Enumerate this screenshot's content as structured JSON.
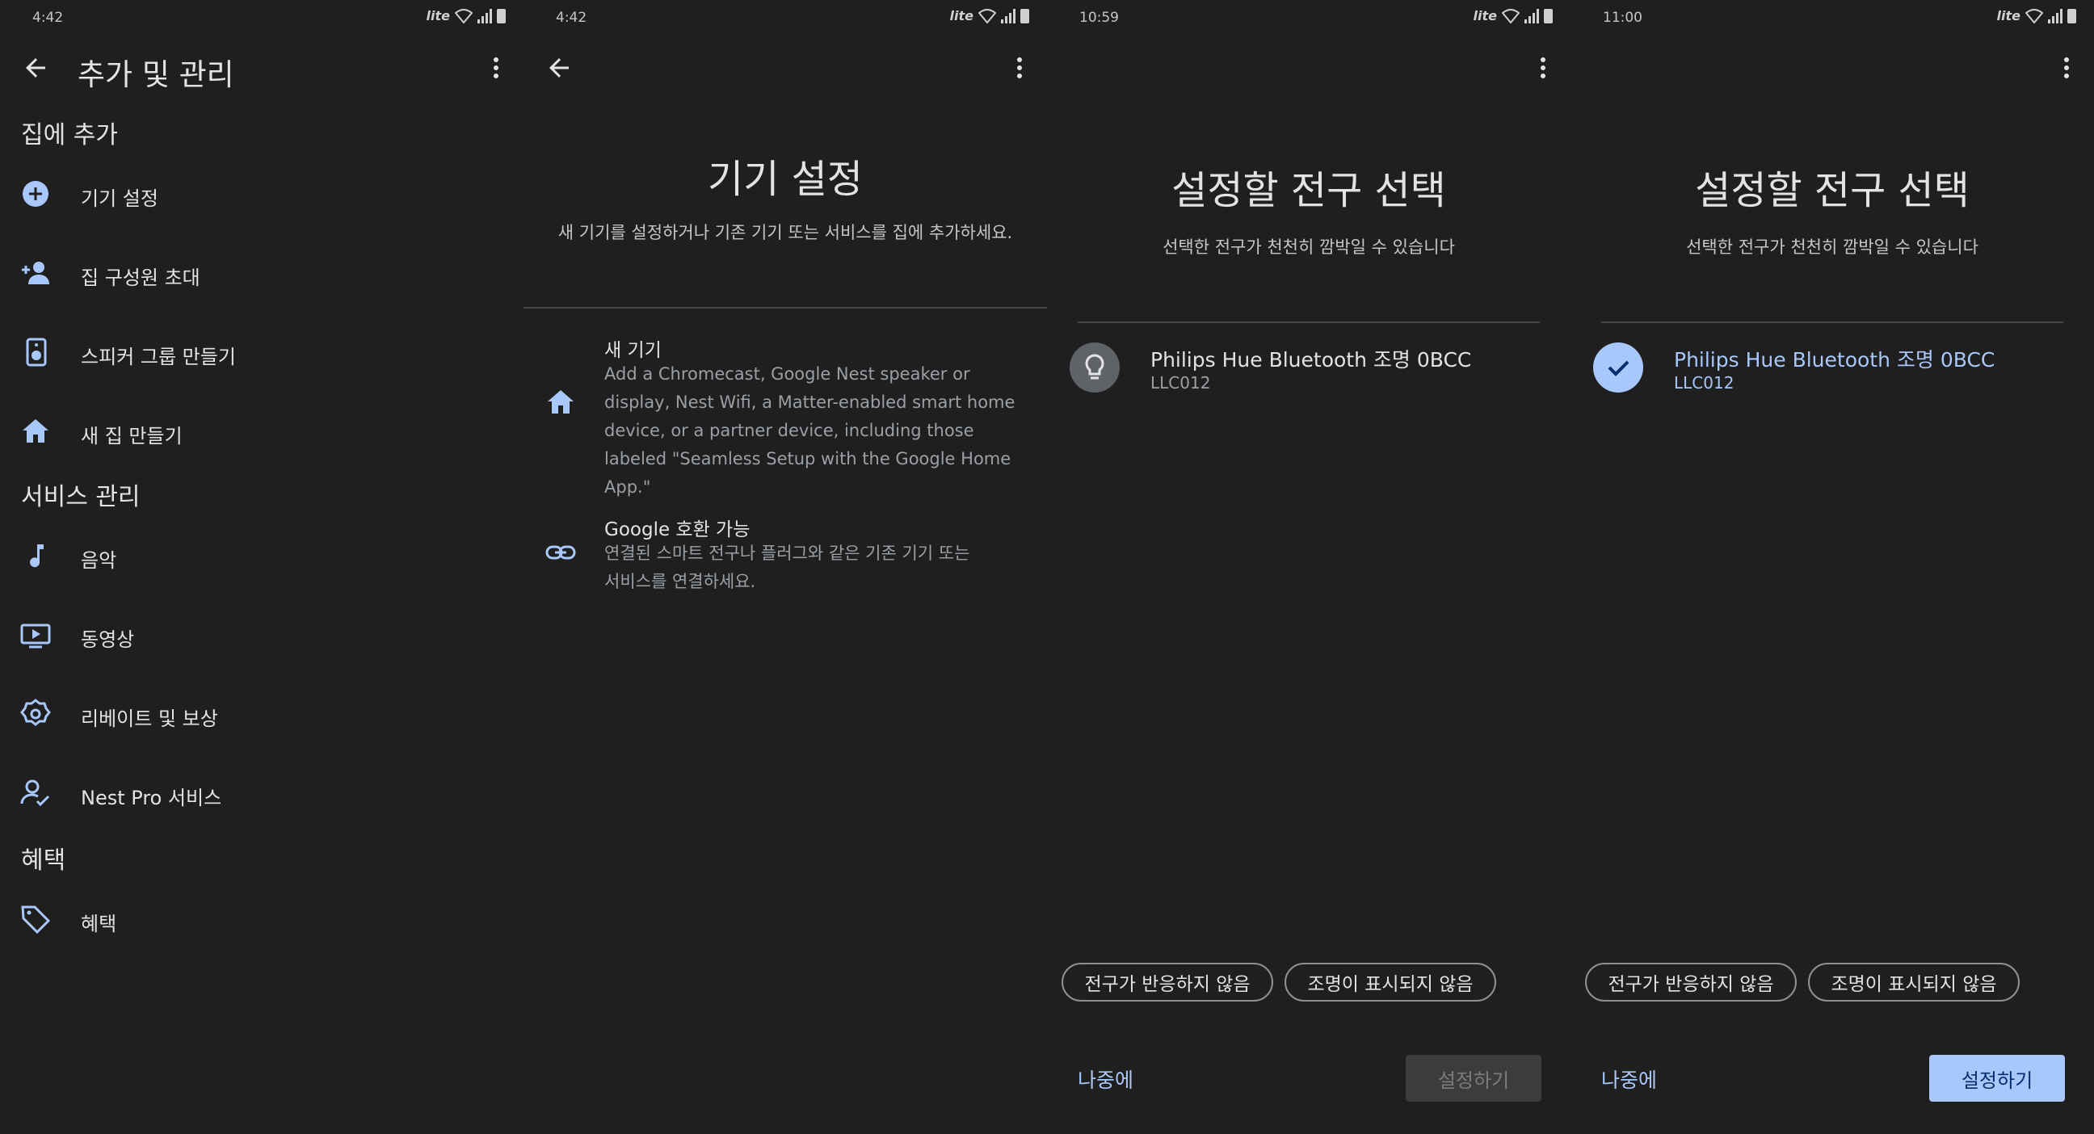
{
  "screens": {
    "s1": {
      "time": "4:42",
      "network": "lite",
      "title": "추가 및 관리",
      "sections": {
        "home": "집에 추가",
        "services": "서비스 관리",
        "offers": "혜택"
      },
      "items": {
        "device_setup": "기기 설정",
        "invite": "집 구성원 초대",
        "speaker_group": "스피커 그룹 만들기",
        "new_home": "새 집 만들기",
        "music": "음악",
        "video": "동영상",
        "rebates": "리베이트 및 보상",
        "nest_pro": "Nest Pro 서비스",
        "offers": "혜택"
      }
    },
    "s2": {
      "time": "4:42",
      "network": "lite",
      "title": "기기 설정",
      "subtitle": "새 기기를 설정하거나 기존 기기 또는 서비스를 집에 추가하세요.",
      "new_device": {
        "title": "새 기기",
        "description": "Add a Chromecast, Google Nest speaker or display, Nest Wifi, a Matter-enabled smart home device, or a partner device, including those labeled \"Seamless Setup with the Google Home App.\""
      },
      "works_with": {
        "title": "Google 호환 가능",
        "description": "연결된 스마트 전구나 플러그와 같은 기존 기기 또는 서비스를 연결하세요."
      }
    },
    "s3": {
      "time": "10:59",
      "network": "lite",
      "title": "설정할 전구 선택",
      "subtitle": "선택한 전구가 천천히 깜박일 수 있습니다",
      "bulb_name": "Philips Hue Bluetooth 조명 0BCC",
      "bulb_model": "LLC012",
      "chip_no_response": "전구가 반응하지 않음",
      "chip_not_shown": "조명이 표시되지 않음",
      "later": "나중에",
      "setup": "설정하기"
    },
    "s4": {
      "time": "11:00",
      "network": "lite",
      "title": "설정할 전구 선택",
      "subtitle": "선택한 전구가 천천히 깜박일 수 있습니다",
      "bulb_name": "Philips Hue Bluetooth 조명 0BCC",
      "bulb_model": "LLC012",
      "chip_no_response": "전구가 반응하지 않음",
      "chip_not_shown": "조명이 표시되지 않음",
      "later": "나중에",
      "setup": "설정하기"
    }
  },
  "colors": {
    "background": "#1f1f1f",
    "accent": "#a8c7fa",
    "icon": "#a8c7fa",
    "disabled_button": "#3c3c3c"
  },
  "icons": [
    "back-arrow-icon",
    "more-vert-icon",
    "add-circle-icon",
    "person-add-icon",
    "speaker-icon",
    "home-icon",
    "music-note-icon",
    "tv-play-icon",
    "badge-settings-icon",
    "person-check-icon",
    "tag-icon",
    "link-icon",
    "lightbulb-icon",
    "check-icon"
  ]
}
